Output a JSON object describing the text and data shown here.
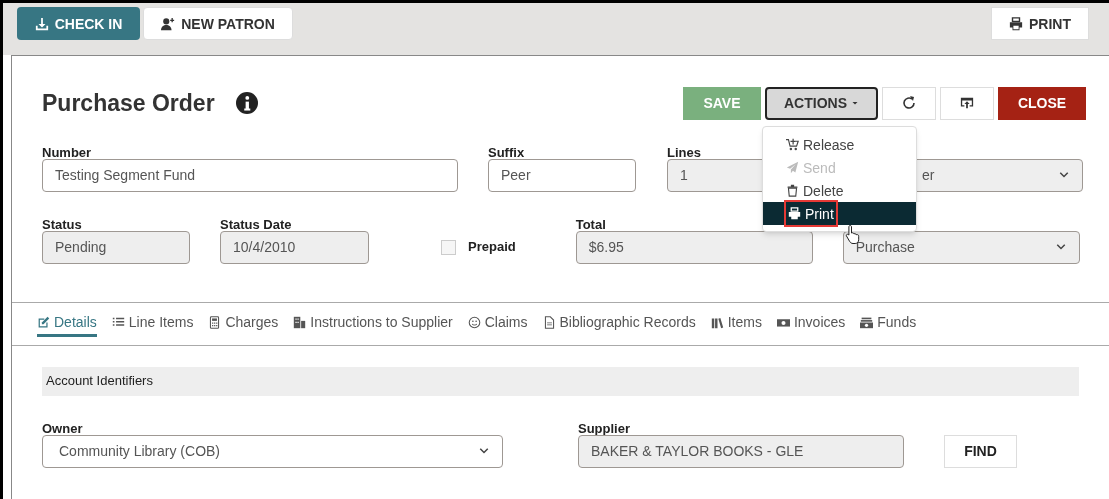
{
  "toolbar": {
    "buttons": [
      {
        "label": "CHECK IN",
        "kind": "checkin"
      },
      {
        "label": "NEW PATRON",
        "kind": "patron"
      }
    ],
    "print": "PRINT"
  },
  "header": {
    "title": "Purchase Order",
    "buttons": [
      {
        "label": "SAVE",
        "kind": "save"
      },
      {
        "label": "ACTIONS",
        "kind": "actions"
      },
      {
        "kind": "refresh"
      },
      {
        "kind": "export"
      },
      {
        "label": "CLOSE",
        "kind": "close"
      }
    ]
  },
  "actions_menu": [
    {
      "label": "Release",
      "kind": "cart",
      "disabled": false,
      "selected": false
    },
    {
      "label": "Send",
      "kind": "send",
      "disabled": true,
      "selected": false
    },
    {
      "label": "Delete",
      "kind": "trash",
      "disabled": false,
      "selected": false
    },
    {
      "label": "Print",
      "kind": "print",
      "disabled": false,
      "selected": true
    }
  ],
  "row1": [
    {
      "label": "Number",
      "value": "Testing Segment Fund",
      "kind": "text",
      "readonly": false
    },
    {
      "label": "Suffix",
      "value": "Peer",
      "kind": "text",
      "readonly": false
    },
    {
      "label": "Lines",
      "value": "1",
      "kind": "text",
      "readonly": true
    },
    {
      "value": "er",
      "kind": "select",
      "readonly": true
    }
  ],
  "row2": {
    "status": {
      "label": "Status",
      "value": "Pending"
    },
    "status_date": {
      "label": "Status Date",
      "value": "10/4/2010"
    },
    "prepaid": {
      "label": "Prepaid",
      "checked": false
    },
    "total": {
      "label": "Total",
      "value": "$6.95"
    },
    "type": {
      "value": "Purchase"
    }
  },
  "tabs": [
    {
      "label": "Details",
      "kind": "edit",
      "selected": true
    },
    {
      "label": "Line Items",
      "kind": "list",
      "selected": false
    },
    {
      "label": "Charges",
      "kind": "calc",
      "selected": false
    },
    {
      "label": "Instructions to Supplier",
      "kind": "building",
      "selected": false
    },
    {
      "label": "Claims",
      "kind": "smile",
      "selected": false
    },
    {
      "label": "Bibliographic Records",
      "kind": "doc",
      "selected": false
    },
    {
      "label": "Items",
      "kind": "books",
      "selected": false
    },
    {
      "label": "Invoices",
      "kind": "money",
      "selected": false
    },
    {
      "label": "Funds",
      "kind": "funds",
      "selected": false
    }
  ],
  "section": "Account Identifiers",
  "owner": {
    "label": "Owner",
    "value": "Community Library (COB)"
  },
  "supplier": {
    "label": "Supplier",
    "value": "BAKER & TAYLOR BOOKS - GLE",
    "button": "FIND"
  }
}
